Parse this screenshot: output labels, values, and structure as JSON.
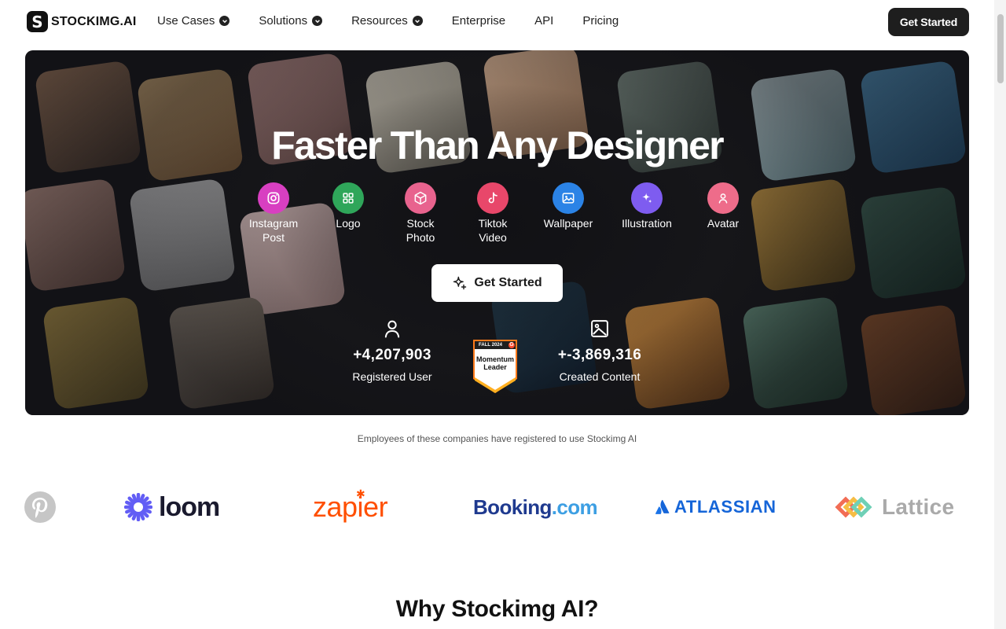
{
  "nav": {
    "logo_text": "STOCKIMG.AI",
    "logo_glyph": "S",
    "links": [
      {
        "label": "Use Cases",
        "dropdown": true
      },
      {
        "label": "Solutions",
        "dropdown": true
      },
      {
        "label": "Resources",
        "dropdown": true
      },
      {
        "label": "Enterprise",
        "dropdown": false
      },
      {
        "label": "API",
        "dropdown": false
      },
      {
        "label": "Pricing",
        "dropdown": false
      }
    ],
    "cta": "Get Started"
  },
  "hero": {
    "title": "Faster Than Any Designer",
    "categories": [
      {
        "label": "Instagram Post",
        "icon": "instagram-icon",
        "color": "#d83fc1"
      },
      {
        "label": "Logo",
        "icon": "grid-icon",
        "color": "#2fa65a"
      },
      {
        "label": "Stock Photo",
        "icon": "box-icon",
        "color": "#e8638e"
      },
      {
        "label": "Tiktok Video",
        "icon": "tiktok-icon",
        "color": "#e8476a"
      },
      {
        "label": "Wallpaper",
        "icon": "image-icon",
        "color": "#2b83e6"
      },
      {
        "label": "Illustration",
        "icon": "sparkle-icon",
        "color": "#7e5cf0"
      },
      {
        "label": "Avatar",
        "icon": "person-icon",
        "color": "#ee6c8a"
      }
    ],
    "cta": "Get Started",
    "stats": {
      "users_value": "+4,207,903",
      "users_label": "Registered User",
      "content_value": "+-3,869,316",
      "content_label": "Created Content"
    },
    "badge": {
      "season": "FALL 2024",
      "line1": "Momentum",
      "line2": "Leader",
      "brand_letter": "G"
    }
  },
  "partners": {
    "caption": "Employees of these companies have registered to use Stockimg AI",
    "brands": [
      {
        "name": "Pinterest",
        "color": "#bdbdbd"
      },
      {
        "name": "loom",
        "color": "#625df5"
      },
      {
        "name": "zapier",
        "color": "#ff4f00"
      },
      {
        "name": "Booking",
        "suffix": ".com",
        "color": "#1f3a8f",
        "accent": "#3d9fe3"
      },
      {
        "name": "ATLASSIAN",
        "color": "#1565d8"
      },
      {
        "name": "Lattice",
        "color": "#aaaaaa"
      }
    ]
  },
  "section": {
    "title": "Why Stockimg AI?"
  }
}
